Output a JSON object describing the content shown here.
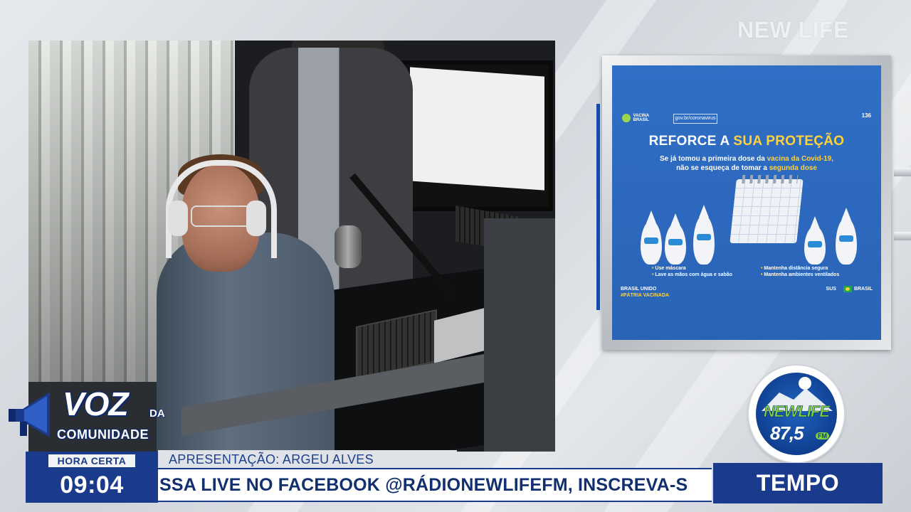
{
  "brand": {
    "corner_text": "NEW LIFE"
  },
  "poster": {
    "logo_left": "VACINA BRASIL",
    "logo_mid": "gov.br/coronavirus",
    "number": "136",
    "headline_main": "REFORCE A",
    "headline_highlight": "SUA PROTEÇÃO",
    "sub_line1_a": "Se já tomou a primeira dose da ",
    "sub_line1_b": "vacina da Covid-19,",
    "sub_line2_a": "não se esqueça de tomar a ",
    "sub_line2_b": "segunda dose",
    "tips": [
      "Use máscara",
      "Mantenha distância segura",
      "Lave as mãos com água e sabão",
      "Mantenha ambientes ventilados"
    ],
    "footer_left_1": "BRASIL UNIDO",
    "footer_left_2": "#PÁTRIA VACINADA",
    "footer_right_sus": "SUS",
    "footer_right_brasil": "BRASIL"
  },
  "station_logo": {
    "name": "NEWLIFE",
    "frequency": "87,5",
    "band": "FM"
  },
  "program": {
    "title_main": "VOZ",
    "title_da": "DA",
    "title_sub": "COMUNIDADE"
  },
  "clock": {
    "label": "HORA CERTA",
    "time": "09:04"
  },
  "presenter": {
    "text": "APRESENTAÇÃO: ARGEU ALVES"
  },
  "ticker": {
    "text": "SSA LIVE NO FACEBOOK @RÁDIONEWLIFEFM, INSCREVA-S"
  },
  "weather": {
    "label": "TEMPO"
  },
  "colors": {
    "primary_blue": "#1a3a8c",
    "poster_blue": "#2f6fc6",
    "accent_yellow": "#ffd23a",
    "logo_green": "#7ed23c"
  }
}
